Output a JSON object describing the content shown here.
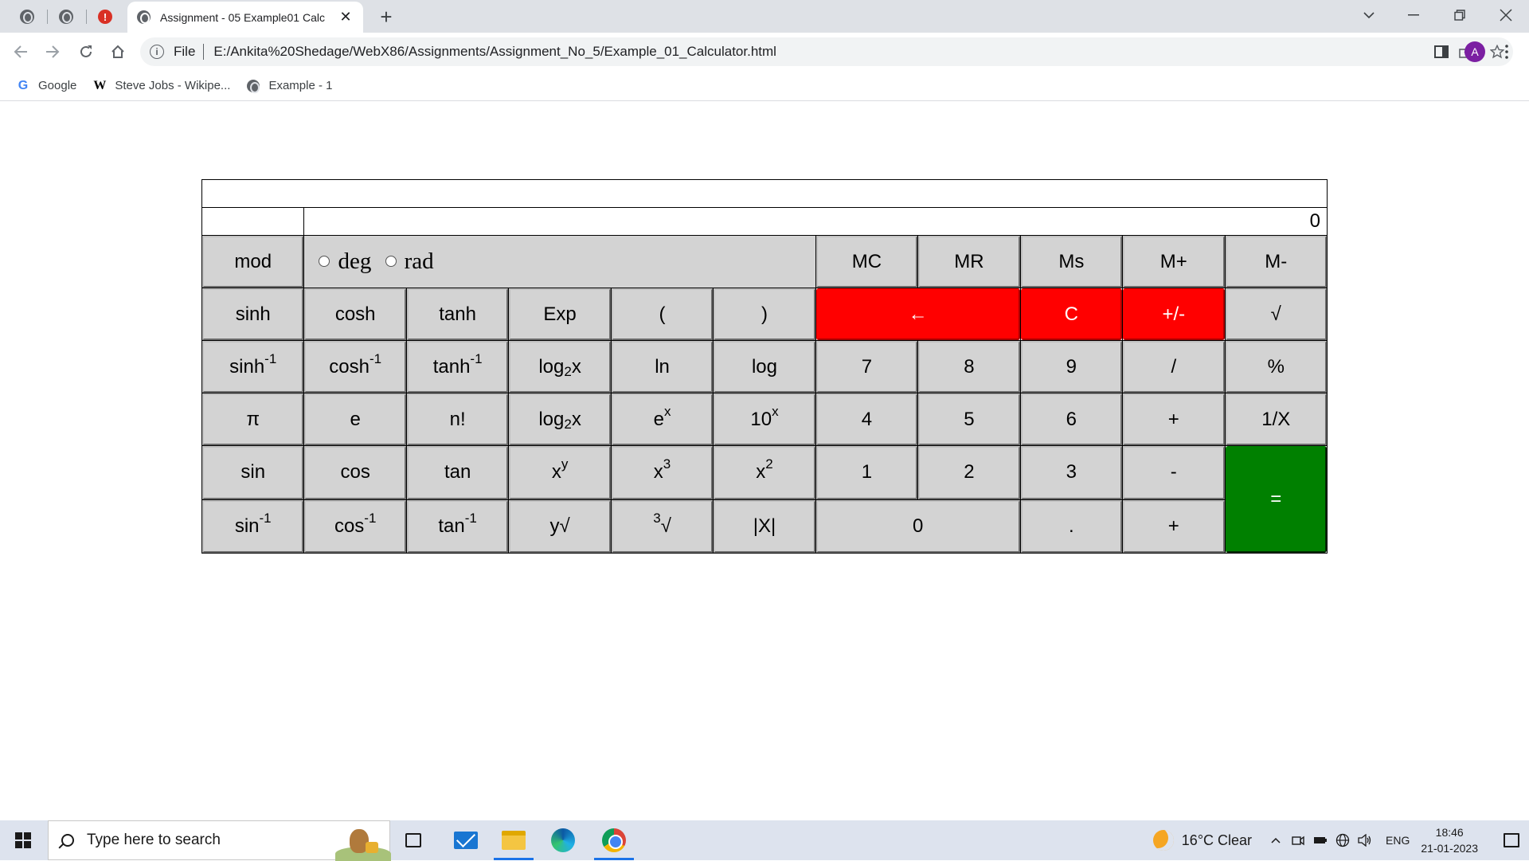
{
  "browser": {
    "tab_title": "Assignment - 05 Example01 Calc",
    "tab_close": "✕",
    "new_tab": "+",
    "scheme_label": "File",
    "url": "E:/Ankita%20Shedage/WebX86/Assignments/Assignment_No_5/Example_01_Calculator.html",
    "profile_initial": "A",
    "bookmarks": [
      {
        "label": "Google",
        "icon": "google-icon"
      },
      {
        "label": "Steve Jobs - Wikipe...",
        "icon": "wikipedia-icon"
      },
      {
        "label": "Example - 1",
        "icon": "globe-icon"
      }
    ]
  },
  "calculator": {
    "display_value": "0",
    "angle_modes": [
      "deg",
      "rad"
    ],
    "rows": [
      [
        "mod",
        "MC",
        "MR",
        "Ms",
        "M+",
        "M-"
      ],
      [
        "sinh",
        "cosh",
        "tanh",
        "Exp",
        "(",
        ")",
        "←",
        "C",
        "+/-",
        "√"
      ],
      [
        "sinh-1",
        "cosh-1",
        "tanh-1",
        "log2x",
        "ln",
        "log",
        "7",
        "8",
        "9",
        "/",
        "%"
      ],
      [
        "π",
        "e",
        "n!",
        "log2x",
        "ex",
        "10x",
        "4",
        "5",
        "6",
        "+",
        "1/X"
      ],
      [
        "sin",
        "cos",
        "tan",
        "xy",
        "x3",
        "x2",
        "1",
        "2",
        "3",
        "-",
        "="
      ],
      [
        "sin-1",
        "cos-1",
        "tan-1",
        "y√",
        "3√",
        "|X|",
        "0",
        ".",
        "+"
      ]
    ],
    "accent_colors": {
      "danger": "#ff0000",
      "equals": "#008000",
      "key": "#d3d3d3"
    }
  },
  "taskbar": {
    "search_placeholder": "Type here to search",
    "weather": "16°C  Clear",
    "language": "ENG",
    "time": "18:46",
    "date": "21-01-2023"
  }
}
